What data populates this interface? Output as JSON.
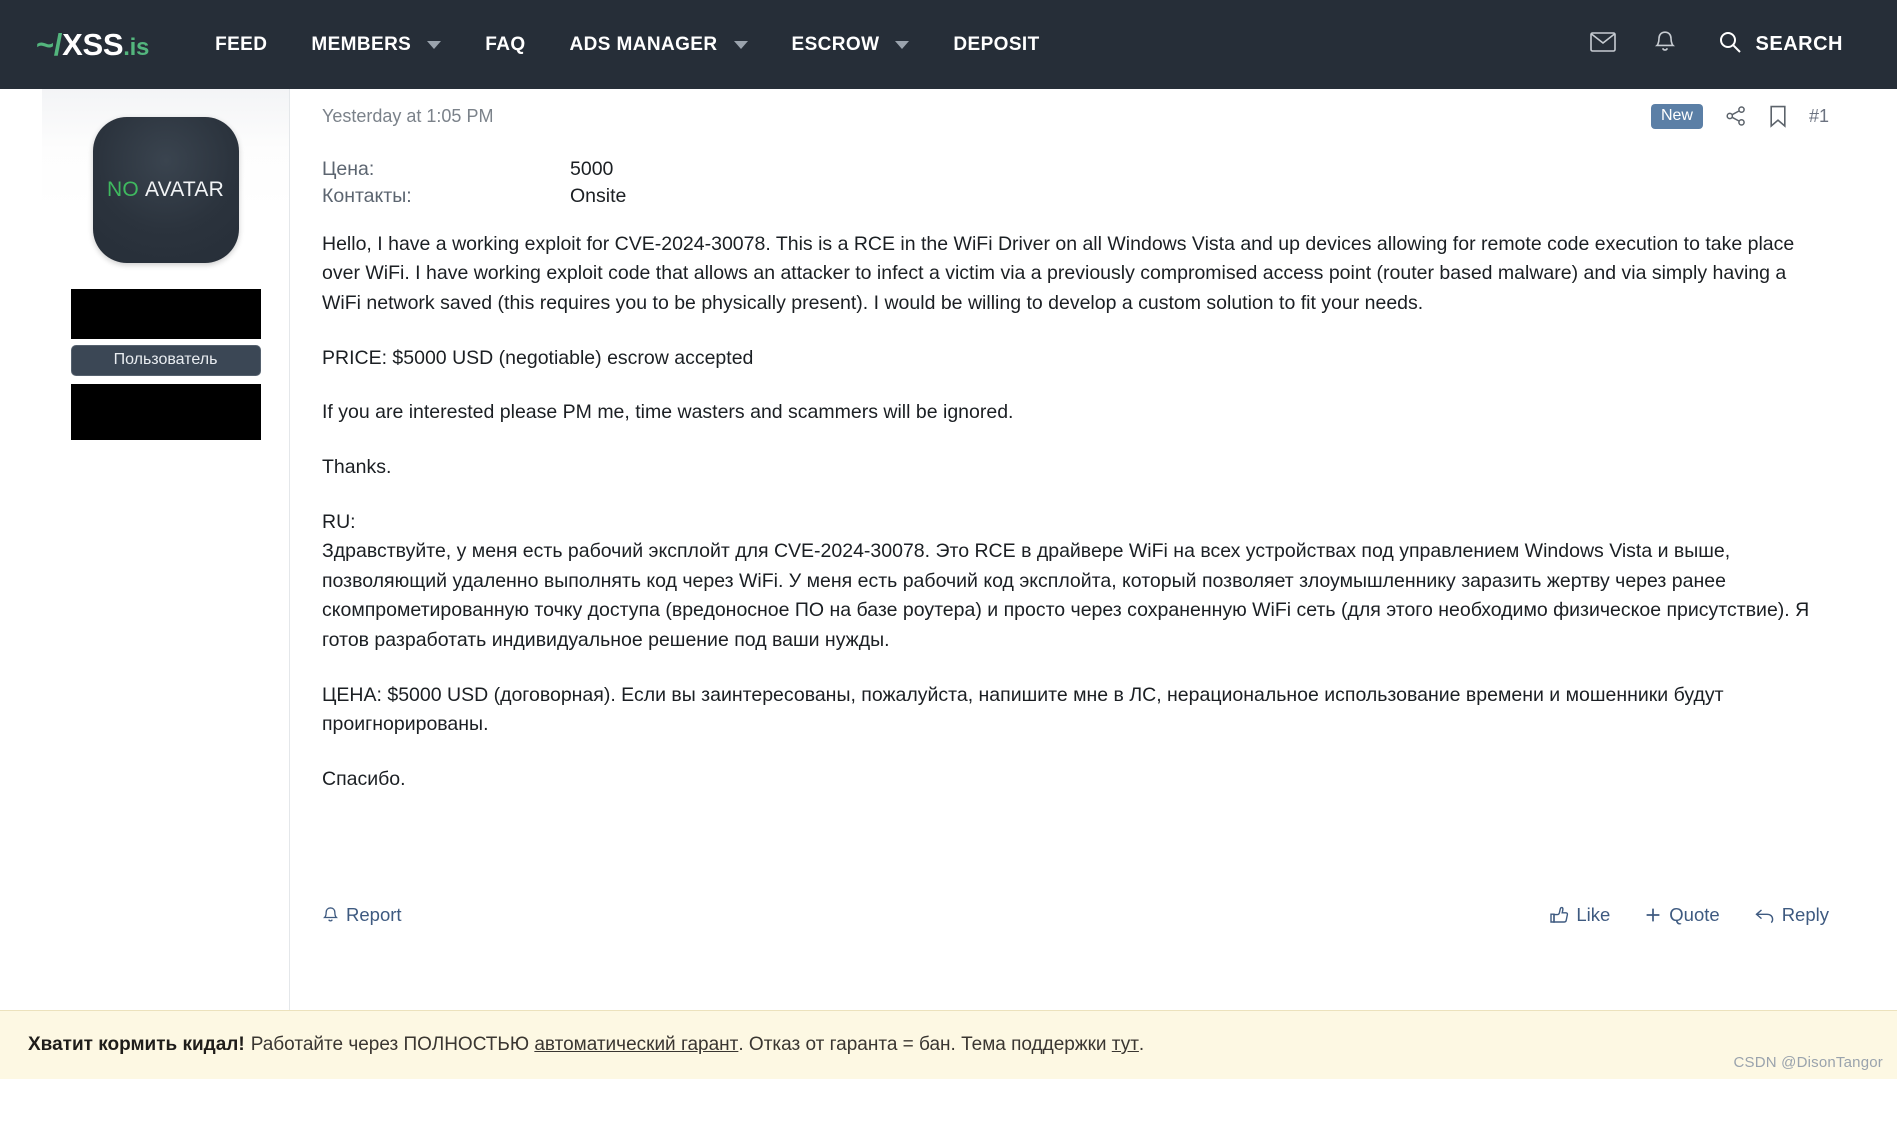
{
  "navbar": {
    "brand": {
      "prefix": "~/",
      "name": "XSS",
      "suffix": ".is"
    },
    "items": [
      {
        "label": "FEED",
        "has_caret": false
      },
      {
        "label": "MEMBERS",
        "has_caret": true
      },
      {
        "label": "FAQ",
        "has_caret": false
      },
      {
        "label": "ADS MANAGER",
        "has_caret": true
      },
      {
        "label": "ESCROW",
        "has_caret": true
      },
      {
        "label": "DEPOSIT",
        "has_caret": false
      }
    ],
    "mail_icon": "envelope-icon",
    "bell_icon": "bell-icon",
    "search_label": "SEARCH",
    "search_icon": "search-icon",
    "background": "#262e38",
    "accent": "#53b57d"
  },
  "post": {
    "date": "Yesterday at 1:05 PM",
    "badge_new": "New",
    "share_icon": "share-icon",
    "bookmark_icon": "bookmark-icon",
    "post_number": "#1",
    "user": {
      "avatar_text_1": "NO",
      "avatar_text_2": "AVATAR",
      "role_badge": "Пользователь",
      "redacted_name": "",
      "redacted_stats": ""
    },
    "fields": [
      {
        "key": "Цена:",
        "value": "5000"
      },
      {
        "key": "Контакты:",
        "value": "Onsite"
      }
    ],
    "paragraphs": [
      "Hello, I have a working exploit for CVE-2024-30078. This is a RCE in the WiFi Driver on all Windows Vista and up devices allowing for remote code execution to take place over WiFi. I have working exploit code that allows an attacker to infect a victim via a previously compromised access point (router based malware) and via simply having a WiFi network saved (this requires you to be physically present). I would be willing to develop a custom solution to fit your needs.",
      "PRICE: $5000 USD (negotiable) escrow accepted",
      "If you are interested please PM me, time wasters and scammers will be ignored.",
      "Thanks."
    ],
    "ru_heading": "RU:",
    "ru_paragraphs": [
      "Здравствуйте, у меня есть рабочий эксплойт для CVE-2024-30078. Это RCE в драйвере WiFi на всех устройствах под управлением Windows Vista и выше, позволяющий удаленно выполнять код через WiFi. У меня есть рабочий код эксплойта, который позволяет злоумышленнику заразить жертву через ранее скомпрометированную точку доступа (вредоносное ПО на базе роутера) и просто через сохраненную WiFi сеть (для этого необходимо физическое присутствие). Я готов разработать индивидуальное решение под ваши нужды.",
      "ЦЕНА: $5000 USD (договорная). Если вы заинтересованы, пожалуйста, напишите мне в ЛС, нерациональное использование времени и мошенники будут проигнорированы.",
      "Спасибо."
    ],
    "actions": {
      "report": "Report",
      "report_icon": "bell-icon",
      "like": "Like",
      "like_icon": "thumbs-up-icon",
      "quote": "Quote",
      "quote_icon": "plus-icon",
      "reply": "Reply",
      "reply_icon": "reply-arrow-icon"
    }
  },
  "warning": {
    "bold": "Хватит кормить кидал!",
    "text_1": "Работайте через ПОЛНОСТЬЮ",
    "link_1": "автоматический гарант",
    "text_2": ". Отказ от гаранта = бан. Тема поддержки",
    "link_2": "тут",
    "text_3": ".",
    "background": "#fdf8e3"
  },
  "watermark": "CSDN @DisonTangor"
}
